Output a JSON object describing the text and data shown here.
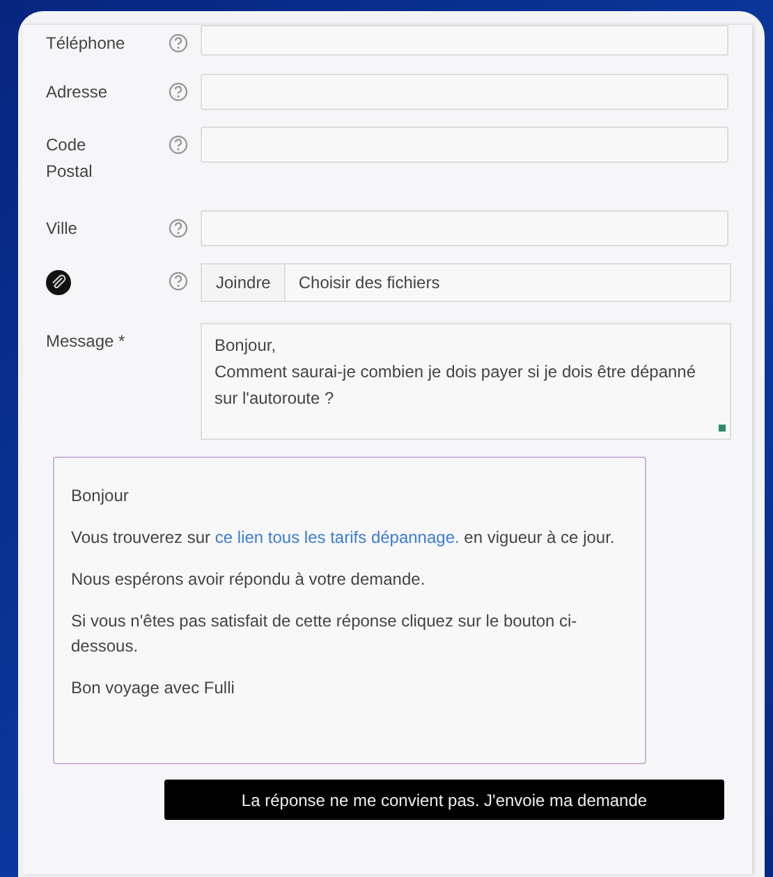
{
  "fields": [
    {
      "kind": "text",
      "label": "Téléphone"
    },
    {
      "kind": "text",
      "label": "Adresse"
    },
    {
      "kind": "text",
      "label": "Code Postal"
    },
    {
      "kind": "text",
      "label": "Ville"
    },
    {
      "kind": "file",
      "button": "Joindre",
      "placeholder": "Choisir des fichiers"
    },
    {
      "kind": "textarea",
      "label": "Message *",
      "value": "Bonjour,\nComment saurai-je combien je dois payer si je dois être dépanné sur l'autoroute ?"
    }
  ],
  "reply": {
    "paragraphs": [
      {
        "text": "Bonjour"
      },
      {
        "text": "Vous trouverez sur ",
        "link": "ce lien tous les tarifs dépannage.",
        "after": " en vigueur à ce jour."
      },
      {
        "text": "Nous espérons avoir répondu à votre demande."
      },
      {
        "text": "Si vous n'êtes pas satisfait de cette réponse cliquez sur le bouton ci-dessous."
      },
      {
        "text": "Bon voyage avec Fulli"
      }
    ]
  },
  "submit_button": "La réponse ne me convient pas. J'envoie ma demande"
}
